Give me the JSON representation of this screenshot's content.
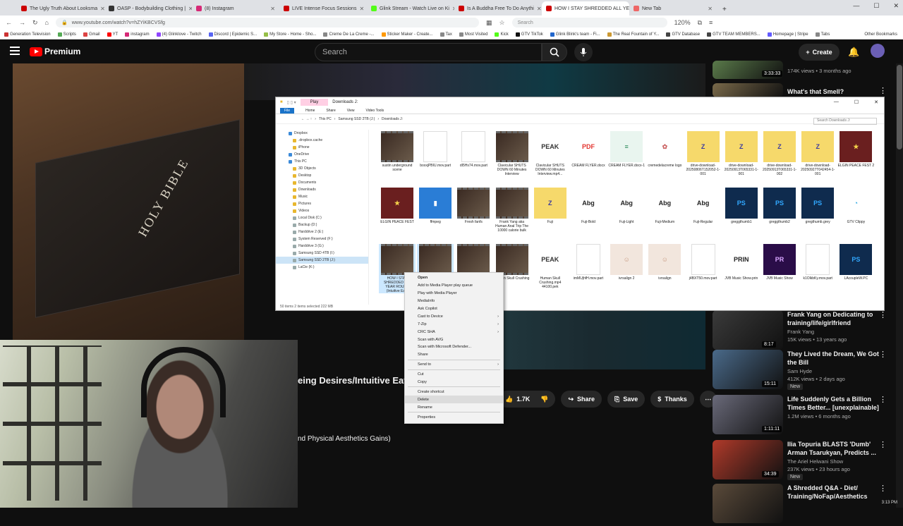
{
  "browser": {
    "tabs": [
      {
        "label": "The Ugly Truth About Looksma",
        "color": "#c00"
      },
      {
        "label": "OASP - Bodybuilding Clothing |",
        "color": "#333"
      },
      {
        "label": "(8) Instagram",
        "color": "#d62976"
      },
      {
        "label": "LIVE Intense Focus Sessions",
        "color": "#c00"
      },
      {
        "label": "Glink Stream - Watch Live on Ki",
        "color": "#53fc18"
      },
      {
        "label": "Is A Buddha Free To Do Anythi",
        "color": "#c00"
      },
      {
        "label": "HOW I STAY SHREDDED ALL YE",
        "color": "#c00",
        "active": true
      },
      {
        "label": "New Tab",
        "color": "#e66"
      }
    ],
    "url": "www.youtube.com/watch?v=hZYiKBCVSfg",
    "search_placeholder": "Search",
    "zoom": "120%",
    "bookmarks": [
      "Generation Television",
      "Scripts",
      "Gmail",
      "YT",
      "instagram",
      "(4) Glinklove - Twitch",
      "Discord | Epidemic S...",
      "My Store - Home - Sho...",
      "Creme De La Creme -...",
      "Sticker Maker - Create...",
      "Tax",
      "Most Visited",
      "Kick",
      "GTV TikTok",
      "Glink Blink's team - Fi...",
      "The Real Fountain of Y...",
      "GTV Database",
      "GTV TEAM MEMBERS...",
      "Homepage | Stripe",
      "Tabs"
    ],
    "other_bookmarks": "Other Bookmarks"
  },
  "youtube": {
    "logo": "Premium",
    "search_placeholder": "Search",
    "create_label": "Create",
    "video_title_fragment": "eing Desires/Intuitive Eating)",
    "video_desc_fragment": "nd Physical Aesthetics Gains)",
    "bible_text": "HOLY BIBLE",
    "likes": "1.7K",
    "share": "Share",
    "save": "Save",
    "thanks": "Thanks"
  },
  "explorer": {
    "ribbon_play": "Play",
    "window_title": "Downloads J:",
    "ribbon_tabs": [
      "File",
      "Home",
      "Share",
      "View",
      "Video Tools"
    ],
    "path": [
      "This PC",
      "Samsung SSD 2TB (J:)",
      "Downloads J:"
    ],
    "search_placeholder": "Search Downloads J:",
    "nav": [
      {
        "label": "Dropbox",
        "indent": false
      },
      {
        "label": ".dropbox.cache",
        "indent": true
      },
      {
        "label": "iPhone",
        "indent": true
      },
      {
        "label": "OneDrive",
        "indent": false
      },
      {
        "label": "This PC",
        "indent": false
      },
      {
        "label": "3D Objects",
        "indent": true
      },
      {
        "label": "Desktop",
        "indent": true
      },
      {
        "label": "Documents",
        "indent": true
      },
      {
        "label": "Downloads",
        "indent": true
      },
      {
        "label": "Music",
        "indent": true
      },
      {
        "label": "Pictures",
        "indent": true
      },
      {
        "label": "Videos",
        "indent": true
      },
      {
        "label": "Local Disk (C:)",
        "indent": true
      },
      {
        "label": "Backup (D:)",
        "indent": true
      },
      {
        "label": "Harddrive 2 (E:)",
        "indent": true
      },
      {
        "label": "System Reserved (F:)",
        "indent": true
      },
      {
        "label": "Harddrive 3 (G:)",
        "indent": true
      },
      {
        "label": "Samsung SSD 4TB (I:)",
        "indent": true
      },
      {
        "label": "Samsung SSD 2TB (J:)",
        "indent": true,
        "selected": true
      },
      {
        "label": "LaCie (K:)",
        "indent": true
      }
    ],
    "files": [
      {
        "name": "sustin underground scene",
        "kind": "video",
        "row": 0,
        "col": 0
      },
      {
        "name": "boxxjPBIU.mov.part",
        "kind": "blank",
        "row": 0,
        "col": 1
      },
      {
        "name": "dI5Hs74.mov.part",
        "kind": "blank",
        "row": 0,
        "col": 2
      },
      {
        "name": "Clavicular SHUTS DOWN 60 Minutes Interview",
        "kind": "video",
        "row": 0,
        "col": 3
      },
      {
        "name": "Clavicular SHUTS DOWN 60 Minutes Interview.mp4...",
        "kind": "peak",
        "row": 0,
        "col": 4
      },
      {
        "name": "CREAM FLYER.docx",
        "kind": "pdf",
        "row": 0,
        "col": 5
      },
      {
        "name": "CREAM FLYER.docx-1",
        "kind": "doc",
        "row": 0,
        "col": 6
      },
      {
        "name": "cremedelacreme logo",
        "kind": "logo",
        "row": 0,
        "col": 7
      },
      {
        "name": "drive-download-20250806T152052-1-001",
        "kind": "zip",
        "row": 0,
        "col": 8
      },
      {
        "name": "drive-download-20250913T065331-1-001",
        "kind": "zip",
        "row": 0,
        "col": 9
      },
      {
        "name": "drive-download-20250913T065331-1-002",
        "kind": "zip",
        "row": 0,
        "col": 10
      },
      {
        "name": "drive-download-20250927T042454-1-001",
        "kind": "zip",
        "row": 0,
        "col": 11
      },
      {
        "name": "ELGIN PEACE FEST 2",
        "kind": "poster",
        "row": 0,
        "col": 12
      },
      {
        "name": "ELGIN PEACE FEST",
        "kind": "poster",
        "row": 1,
        "col": 0
      },
      {
        "name": "ffmpeg",
        "kind": "app",
        "row": 1,
        "col": 1
      },
      {
        "name": "Fresh fanfs",
        "kind": "video",
        "row": 1,
        "col": 2
      },
      {
        "name": "Frank Yang aka Human Anal Trip The 10000 calorie bulk",
        "kind": "video",
        "row": 1,
        "col": 3
      },
      {
        "name": "Fuji",
        "kind": "zip",
        "row": 1,
        "col": 4
      },
      {
        "name": "Fuji-Bold",
        "kind": "font",
        "row": 1,
        "col": 5
      },
      {
        "name": "Fuji-Light",
        "kind": "font",
        "row": 1,
        "col": 6
      },
      {
        "name": "Fuji-Medium",
        "kind": "font",
        "row": 1,
        "col": 7
      },
      {
        "name": "Fuji-Regular",
        "kind": "font",
        "row": 1,
        "col": 8
      },
      {
        "name": "greggthumb1",
        "kind": "psd",
        "row": 1,
        "col": 9
      },
      {
        "name": "greggthumb2",
        "kind": "psd",
        "row": 1,
        "col": 10
      },
      {
        "name": "gregthumb.grey",
        "kind": "psd",
        "row": 1,
        "col": 11
      },
      {
        "name": "GTV Clippy",
        "kind": "edge",
        "row": 1,
        "col": 12
      },
      {
        "name": "HOW I STAY SHREDDED ALL YEAR ROUND (Intuitive Ea...",
        "kind": "video",
        "row": 2,
        "col": 0,
        "selected": true
      },
      {
        "name": "",
        "kind": "video",
        "row": 2,
        "col": 1,
        "selected": true
      },
      {
        "name": "",
        "kind": "video",
        "row": 2,
        "col": 2
      },
      {
        "name": "Human Skull Crushing",
        "kind": "video",
        "row": 2,
        "col": 3
      },
      {
        "name": "Human Skull Crushing.mp4 44100.pek",
        "kind": "peak",
        "row": 2,
        "col": 4
      },
      {
        "name": "imMUjhfH.mov.part",
        "kind": "blank",
        "row": 2,
        "col": 5
      },
      {
        "name": "ivrsalign 2",
        "kind": "photo",
        "row": 2,
        "col": 6
      },
      {
        "name": "ivrsalign",
        "kind": "photo",
        "row": 2,
        "col": 7
      },
      {
        "name": "j4BXT50.mov.part",
        "kind": "blank",
        "row": 2,
        "col": 8
      },
      {
        "name": "JVB Music Show.prin",
        "kind": "prin",
        "row": 2,
        "col": 9
      },
      {
        "name": "JVB Music Show",
        "kind": "proj",
        "row": 2,
        "col": 10
      },
      {
        "name": "k1OlkbKy.mov.part",
        "kind": "blank",
        "row": 2,
        "col": 11
      },
      {
        "name": "LAcoupleW.PC",
        "kind": "psd",
        "row": 2,
        "col": 12
      }
    ],
    "status": "50 items    2 items selected  222 MB"
  },
  "context_menu": [
    {
      "label": "Open",
      "bold": true
    },
    {
      "label": "Add to Media Player play queue"
    },
    {
      "label": "Play with Media Player"
    },
    {
      "label": "MediaInfo"
    },
    {
      "label": "Ask Copilot"
    },
    {
      "label": "Cast to Device",
      "sub": true
    },
    {
      "label": "7-Zip",
      "sub": true
    },
    {
      "label": "CRC SHA",
      "sub": true
    },
    {
      "label": "Scan with AVG"
    },
    {
      "label": "Scan with Microsoft Defender..."
    },
    {
      "label": "Share"
    },
    {
      "sep": true
    },
    {
      "label": "Send to",
      "sub": true
    },
    {
      "sep": true
    },
    {
      "label": "Cut"
    },
    {
      "label": "Copy"
    },
    {
      "sep": true
    },
    {
      "label": "Create shortcut"
    },
    {
      "label": "Delete",
      "highlight": true
    },
    {
      "label": "Rename"
    },
    {
      "sep": true
    },
    {
      "label": "Properties"
    }
  ],
  "sidebar": [
    {
      "title": "",
      "channel": "",
      "meta": "174K views • 3 months ago",
      "duration": "3:33:33",
      "color": "#5a7a4a"
    },
    {
      "title": "What's that Smell?",
      "channel": "",
      "meta": "",
      "duration": "",
      "color": "#7a6a4a"
    },
    {
      "title": "Frank Yang on Dedicating to training/life/girlfriend",
      "channel": "Frank Yang",
      "meta": "15K views • 13 years ago",
      "duration": "8:17",
      "color": "#3a3a3a"
    },
    {
      "title": "They Lived the Dream, We Got the Bill",
      "channel": "Sam Hyde",
      "meta": "412K views • 2 days ago",
      "duration": "15:11",
      "badge": "New",
      "color": "#4a6a8a"
    },
    {
      "title": "Life Suddenly Gets a Billion Times Better... [unexplainable]",
      "channel": "",
      "meta": "1.2M views • 6 months ago",
      "duration": "1:11:11",
      "color": "#6a6a7a"
    },
    {
      "title": "Ilia Topuria BLASTS 'Dumb' Arman Tsarukyan, Predicts ...",
      "channel": "The Ariel Helwani Show",
      "meta": "237K views • 23 hours ago",
      "duration": "34:39",
      "badge": "New",
      "color": "#b03a2a"
    },
    {
      "title": "A Shredded Q&A - Diet/ Training/NoFap/Aesthetics",
      "channel": "",
      "meta": "",
      "duration": "",
      "color": "#5a4a3a"
    }
  ],
  "clock": "3:13 PM"
}
